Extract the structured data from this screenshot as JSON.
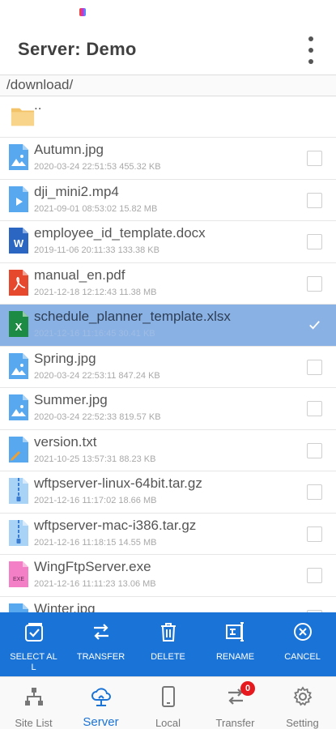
{
  "header": {
    "title": "Server:  Demo"
  },
  "path": "/download/",
  "files": [
    {
      "name": "..",
      "meta": "",
      "type": "folder",
      "selected": false
    },
    {
      "name": "Autumn.jpg",
      "meta": "2020-03-24 22:51:53  455.32 KB",
      "type": "image",
      "selected": false
    },
    {
      "name": "dji_mini2.mp4",
      "meta": "2021-09-01 08:53:02  15.82 MB",
      "type": "video",
      "selected": false
    },
    {
      "name": "employee_id_template.docx",
      "meta": "2019-11-06 20:11:33  133.38 KB",
      "type": "word",
      "selected": false
    },
    {
      "name": "manual_en.pdf",
      "meta": "2021-12-18 12:12:43  11.38 MB",
      "type": "pdf",
      "selected": false
    },
    {
      "name": "schedule_planner_template.xlsx",
      "meta": "2021-12-16 11:16:45  30.41 KB",
      "type": "excel",
      "selected": true
    },
    {
      "name": "Spring.jpg",
      "meta": "2020-03-24 22:53:11  847.24 KB",
      "type": "image",
      "selected": false
    },
    {
      "name": "Summer.jpg",
      "meta": "2020-03-24 22:52:33  819.57 KB",
      "type": "image",
      "selected": false
    },
    {
      "name": "version.txt",
      "meta": "2021-10-25 13:57:31  88.23 KB",
      "type": "text",
      "selected": false
    },
    {
      "name": "wftpserver-linux-64bit.tar.gz",
      "meta": "2021-12-16 11:17:02  18.66 MB",
      "type": "archive",
      "selected": false
    },
    {
      "name": "wftpserver-mac-i386.tar.gz",
      "meta": "2021-12-16 11:18:15  14.55 MB",
      "type": "archive",
      "selected": false
    },
    {
      "name": "WingFtpServer.exe",
      "meta": "2021-12-16 11:11:23  13.06 MB",
      "type": "exe",
      "selected": false
    },
    {
      "name": "Winter.jpg",
      "meta": "",
      "type": "image",
      "selected": false
    }
  ],
  "actions": [
    {
      "label": "SELECT ALL",
      "icon": "select-all-icon"
    },
    {
      "label": "TRANSFER",
      "icon": "transfer-icon"
    },
    {
      "label": "DELETE",
      "icon": "trash-icon"
    },
    {
      "label": "RENAME",
      "icon": "rename-icon"
    },
    {
      "label": "CANCEL",
      "icon": "cancel-icon"
    }
  ],
  "nav": [
    {
      "label": "Site List",
      "icon": "sitemap-icon",
      "active": false
    },
    {
      "label": "Server",
      "icon": "cloud-icon",
      "active": true
    },
    {
      "label": "Local",
      "icon": "phone-icon",
      "active": false
    },
    {
      "label": "Transfer",
      "icon": "transfer-icon",
      "active": false,
      "badge": "0"
    },
    {
      "label": "Setting",
      "icon": "gear-icon",
      "active": false
    }
  ],
  "colors": {
    "accent": "#1a73d6",
    "selected_row": "#8ab1e3",
    "badge": "#e5191e"
  }
}
